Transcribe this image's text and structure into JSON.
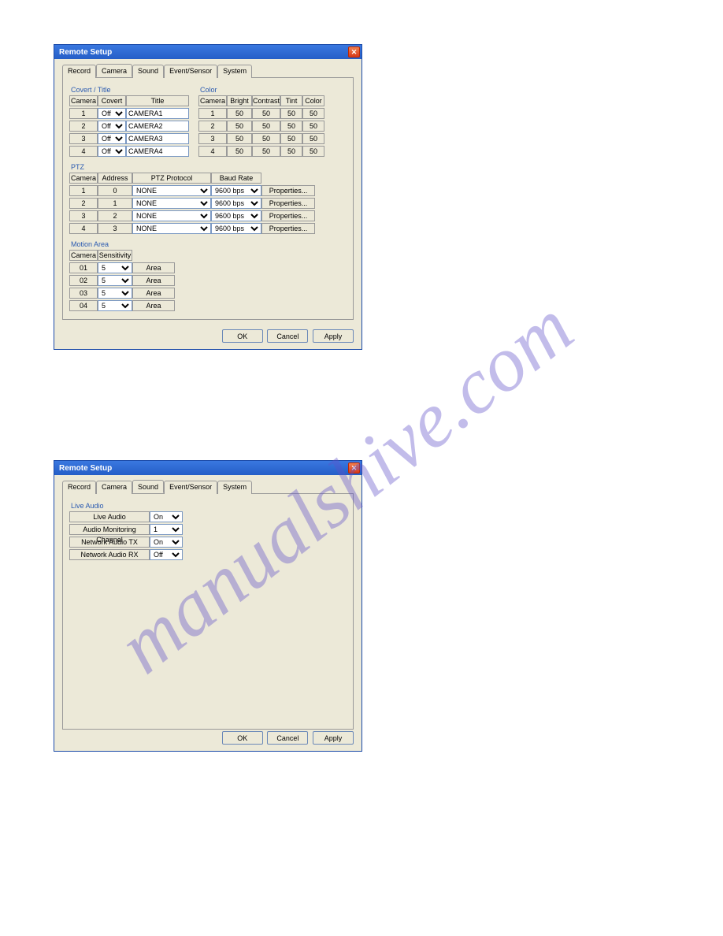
{
  "watermark": "manualshive.com",
  "dialog1": {
    "title": "Remote Setup",
    "close_glyph": "✕",
    "tabs": [
      "Record",
      "Camera",
      "Sound",
      "Event/Sensor",
      "System"
    ],
    "active_tab": 1,
    "covert_title": {
      "section": "Covert / Title",
      "headers": [
        "Camera",
        "Covert",
        "Title"
      ],
      "rows": [
        {
          "cam": "1",
          "covert": "Off",
          "title": "CAMERA1"
        },
        {
          "cam": "2",
          "covert": "Off",
          "title": "CAMERA2"
        },
        {
          "cam": "3",
          "covert": "Off",
          "title": "CAMERA3"
        },
        {
          "cam": "4",
          "covert": "Off",
          "title": "CAMERA4"
        }
      ]
    },
    "color": {
      "section": "Color",
      "headers": [
        "Camera",
        "Bright",
        "Contrast",
        "Tint",
        "Color"
      ],
      "rows": [
        {
          "cam": "1",
          "bright": "50",
          "contrast": "50",
          "tint": "50",
          "color": "50"
        },
        {
          "cam": "2",
          "bright": "50",
          "contrast": "50",
          "tint": "50",
          "color": "50"
        },
        {
          "cam": "3",
          "bright": "50",
          "contrast": "50",
          "tint": "50",
          "color": "50"
        },
        {
          "cam": "4",
          "bright": "50",
          "contrast": "50",
          "tint": "50",
          "color": "50"
        }
      ]
    },
    "ptz": {
      "section": "PTZ",
      "headers": [
        "Camera",
        "Address",
        "PTZ Protocol",
        "Baud Rate"
      ],
      "props_label": "Properties...",
      "rows": [
        {
          "cam": "1",
          "addr": "0",
          "proto": "NONE",
          "baud": "9600 bps"
        },
        {
          "cam": "2",
          "addr": "1",
          "proto": "NONE",
          "baud": "9600 bps"
        },
        {
          "cam": "3",
          "addr": "2",
          "proto": "NONE",
          "baud": "9600 bps"
        },
        {
          "cam": "4",
          "addr": "3",
          "proto": "NONE",
          "baud": "9600 bps"
        }
      ]
    },
    "motion": {
      "section": "Motion Area",
      "headers": [
        "Camera",
        "Sensitivity"
      ],
      "area_label": "Area",
      "rows": [
        {
          "cam": "01",
          "sens": "5"
        },
        {
          "cam": "02",
          "sens": "5"
        },
        {
          "cam": "03",
          "sens": "5"
        },
        {
          "cam": "04",
          "sens": "5"
        }
      ]
    },
    "buttons": {
      "ok": "OK",
      "cancel": "Cancel",
      "apply": "Apply"
    }
  },
  "dialog2": {
    "title": "Remote Setup",
    "close_glyph": "✕",
    "tabs": [
      "Record",
      "Camera",
      "Sound",
      "Event/Sensor",
      "System"
    ],
    "active_tab": 2,
    "live_audio": {
      "section": "Live Audio",
      "rows": [
        {
          "label": "Live Audio",
          "value": "On"
        },
        {
          "label": "Audio Monitoring Channel",
          "value": "1"
        },
        {
          "label": "Network Audio TX",
          "value": "On"
        },
        {
          "label": "Network Audio RX",
          "value": "Off"
        }
      ]
    },
    "buttons": {
      "ok": "OK",
      "cancel": "Cancel",
      "apply": "Apply"
    }
  }
}
